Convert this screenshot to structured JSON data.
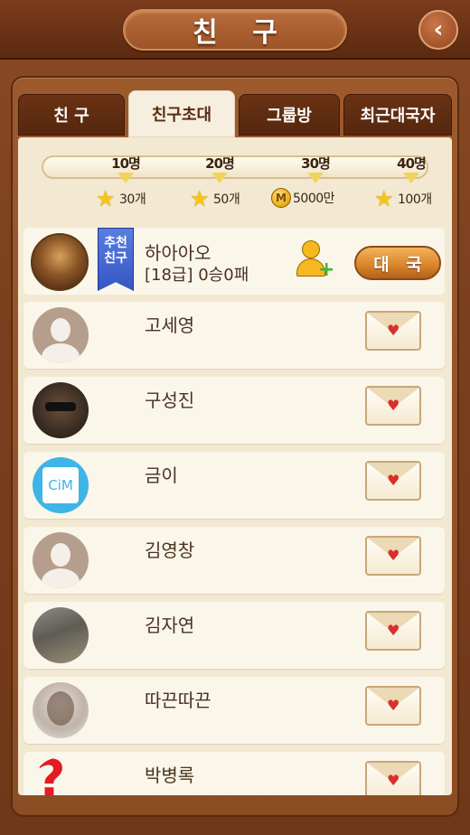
{
  "header": {
    "title": "친 구",
    "back_icon": "chevron-left-icon"
  },
  "tabs": [
    {
      "label": "친 구",
      "active": false
    },
    {
      "label": "친구초대",
      "active": true
    },
    {
      "label": "그룹방",
      "active": false
    },
    {
      "label": "최근대국자",
      "active": false
    }
  ],
  "invite_progress": {
    "milestones": [
      "10명",
      "20명",
      "30명",
      "40명"
    ],
    "rewards": [
      {
        "icon": "star-icon",
        "text": "30개"
      },
      {
        "icon": "star-icon",
        "text": "50개"
      },
      {
        "icon": "money-coin-icon",
        "coin_label": "M",
        "text": "5000만"
      },
      {
        "icon": "star-icon",
        "text": "100개"
      }
    ]
  },
  "recommended": {
    "badge_line1": "추천",
    "badge_line2": "친구",
    "name": "하아아오",
    "info": "[18급]  0승0패",
    "battle_label": "대 국"
  },
  "friends": [
    {
      "name": "고세영"
    },
    {
      "name": "구성진"
    },
    {
      "name": "금이",
      "avatar_text": "CiM"
    },
    {
      "name": "김영창"
    },
    {
      "name": "김자연"
    },
    {
      "name": "따끈따끈"
    },
    {
      "name": "박병록"
    }
  ],
  "colors": {
    "wood": "#8b4d24",
    "content_bg": "#f3e9d2",
    "row_bg": "#fbf6ea",
    "text": "#4a3220",
    "accent_ribbon": "#3656c4",
    "heart": "#d8302c"
  }
}
